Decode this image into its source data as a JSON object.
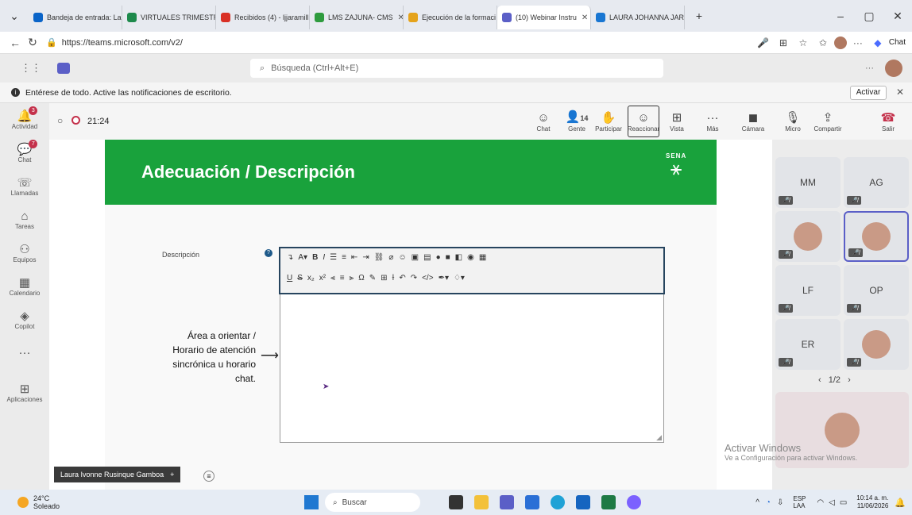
{
  "browser": {
    "tabs": [
      {
        "label": "Bandeja de entrada: La",
        "color": "#0a64c8"
      },
      {
        "label": "VIRTUALES TRIMESTRE",
        "color": "#1e8a4c"
      },
      {
        "label": "Recibidos (4) - ljjaramill",
        "color": "#d93025"
      },
      {
        "label": "LMS ZAJUNA- CMS",
        "color": "#2e9b3e"
      },
      {
        "label": "Ejecución de la formaci",
        "color": "#e5a31b"
      },
      {
        "label": "(10) Webinar Instru",
        "color": "#5b5fc7"
      },
      {
        "label": "LAURA JOHANNA JARA",
        "color": "#1976d2"
      }
    ],
    "url": "https://teams.microsoft.com/v2/",
    "chat_label": "Chat"
  },
  "teams": {
    "search_placeholder": "Búsqueda (Ctrl+Alt+E)",
    "notification": "Entérese de todo. Active las notificaciones de escritorio.",
    "activar_label": "Activar",
    "rail": [
      {
        "label": "Actividad",
        "badge": "3"
      },
      {
        "label": "Chat",
        "badge": "7"
      },
      {
        "label": "Llamadas",
        "badge": ""
      },
      {
        "label": "Tareas",
        "badge": ""
      },
      {
        "label": "Equipos",
        "badge": ""
      },
      {
        "label": "Calendario",
        "badge": ""
      },
      {
        "label": "Copilot",
        "badge": ""
      },
      {
        "label": "",
        "badge": ""
      },
      {
        "label": "Aplicaciones",
        "badge": ""
      }
    ],
    "meeting": {
      "timer": "21:24",
      "people_count": "14",
      "controls": [
        "Chat",
        "Gente",
        "Participar",
        "Reaccionar",
        "Vista",
        "Más",
        "Cámara",
        "Micro",
        "Compartir",
        "Salir"
      ]
    }
  },
  "slide": {
    "title": "Adecuación / Descripción",
    "logo_text": "SENA",
    "field_label": "Descripción",
    "annotation": [
      "Área a orientar /",
      "Horario de atención",
      "sincrónica u horario",
      "chat."
    ],
    "presenter": "Laura Ivonne Rusinque Gamboa"
  },
  "gallery": {
    "tiles": [
      {
        "initials": "MM"
      },
      {
        "initials": "AG"
      },
      {
        "initials": ""
      },
      {
        "initials": ""
      },
      {
        "initials": "LF"
      },
      {
        "initials": "OP"
      },
      {
        "initials": "ER"
      },
      {
        "initials": ""
      }
    ],
    "pager": "1/2",
    "watermark_title": "Activar Windows",
    "watermark_sub": "Ve a Configuración para activar Windows."
  },
  "taskbar": {
    "temp": "24°C",
    "weather": "Soleado",
    "search": "Buscar",
    "lang1": "ESP",
    "lang2": "LAA",
    "time": "10:14 a. m.",
    "date": "11/06/2026"
  }
}
